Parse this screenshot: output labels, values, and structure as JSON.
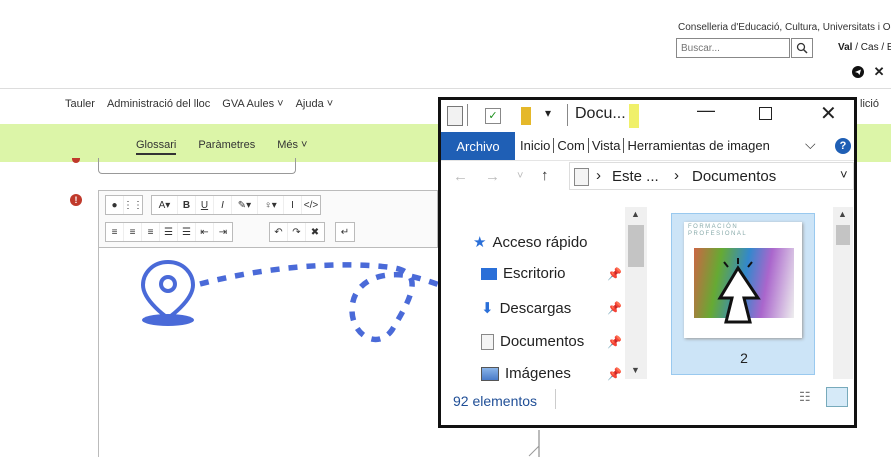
{
  "header": {
    "conselleria": "Conselleria d'Educació, Cultura, Universitats i Oc",
    "search_placeholder": "Buscar...",
    "lang_val": "Val",
    "lang_rest": " / Cas / E"
  },
  "nav": {
    "items": [
      "Tauler",
      "Administració del lloc",
      "GVA Aules ˅",
      "Ajuda ˅"
    ],
    "right_label": "lició"
  },
  "subnav": {
    "items": [
      "Glossari",
      "Paràmetres",
      "Més ˅"
    ]
  },
  "explorer": {
    "title": "Docu...",
    "ribbon": {
      "file_tab": "Archivo",
      "tabs": [
        "Inicio",
        "Com",
        "Vista",
        "Herramientas de imagen"
      ]
    },
    "address": {
      "crumb1": "Este ...",
      "crumb2": "Documentos"
    },
    "nav_items": [
      {
        "label": "Acceso rápido",
        "icon": "star-icon"
      },
      {
        "label": "Escritorio",
        "icon": "desktop-icon"
      },
      {
        "label": "Descargas",
        "icon": "download-icon"
      },
      {
        "label": "Documentos",
        "icon": "documents-icon"
      },
      {
        "label": "Imágenes",
        "icon": "images-icon"
      }
    ],
    "thumbnail": {
      "header_text": "FORMACIÓN PROFESIONAL",
      "label": "2"
    },
    "status": "92 elementos"
  },
  "colors": {
    "accent_blue": "#1f5fb5",
    "green_bar": "#dcf5a8",
    "annotation": "#4a6ad8",
    "error": "#c0392b"
  }
}
